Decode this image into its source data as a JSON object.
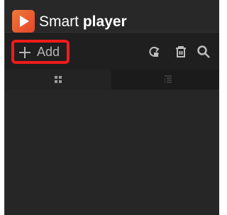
{
  "app": {
    "logo_icon": "play-icon",
    "title_light": "Smart",
    "title_bold": "player",
    "colors": {
      "brand": "#e8542a",
      "highlight": "#f01b1b"
    }
  },
  "toolbar": {
    "add_label": "Add",
    "add_icon": "plus-icon",
    "icons": [
      "refresh-icon",
      "trash-icon",
      "search-icon"
    ]
  },
  "view_tabs": [
    {
      "icon": "grid-icon",
      "active": true
    },
    {
      "icon": "list-icon",
      "active": false
    }
  ]
}
